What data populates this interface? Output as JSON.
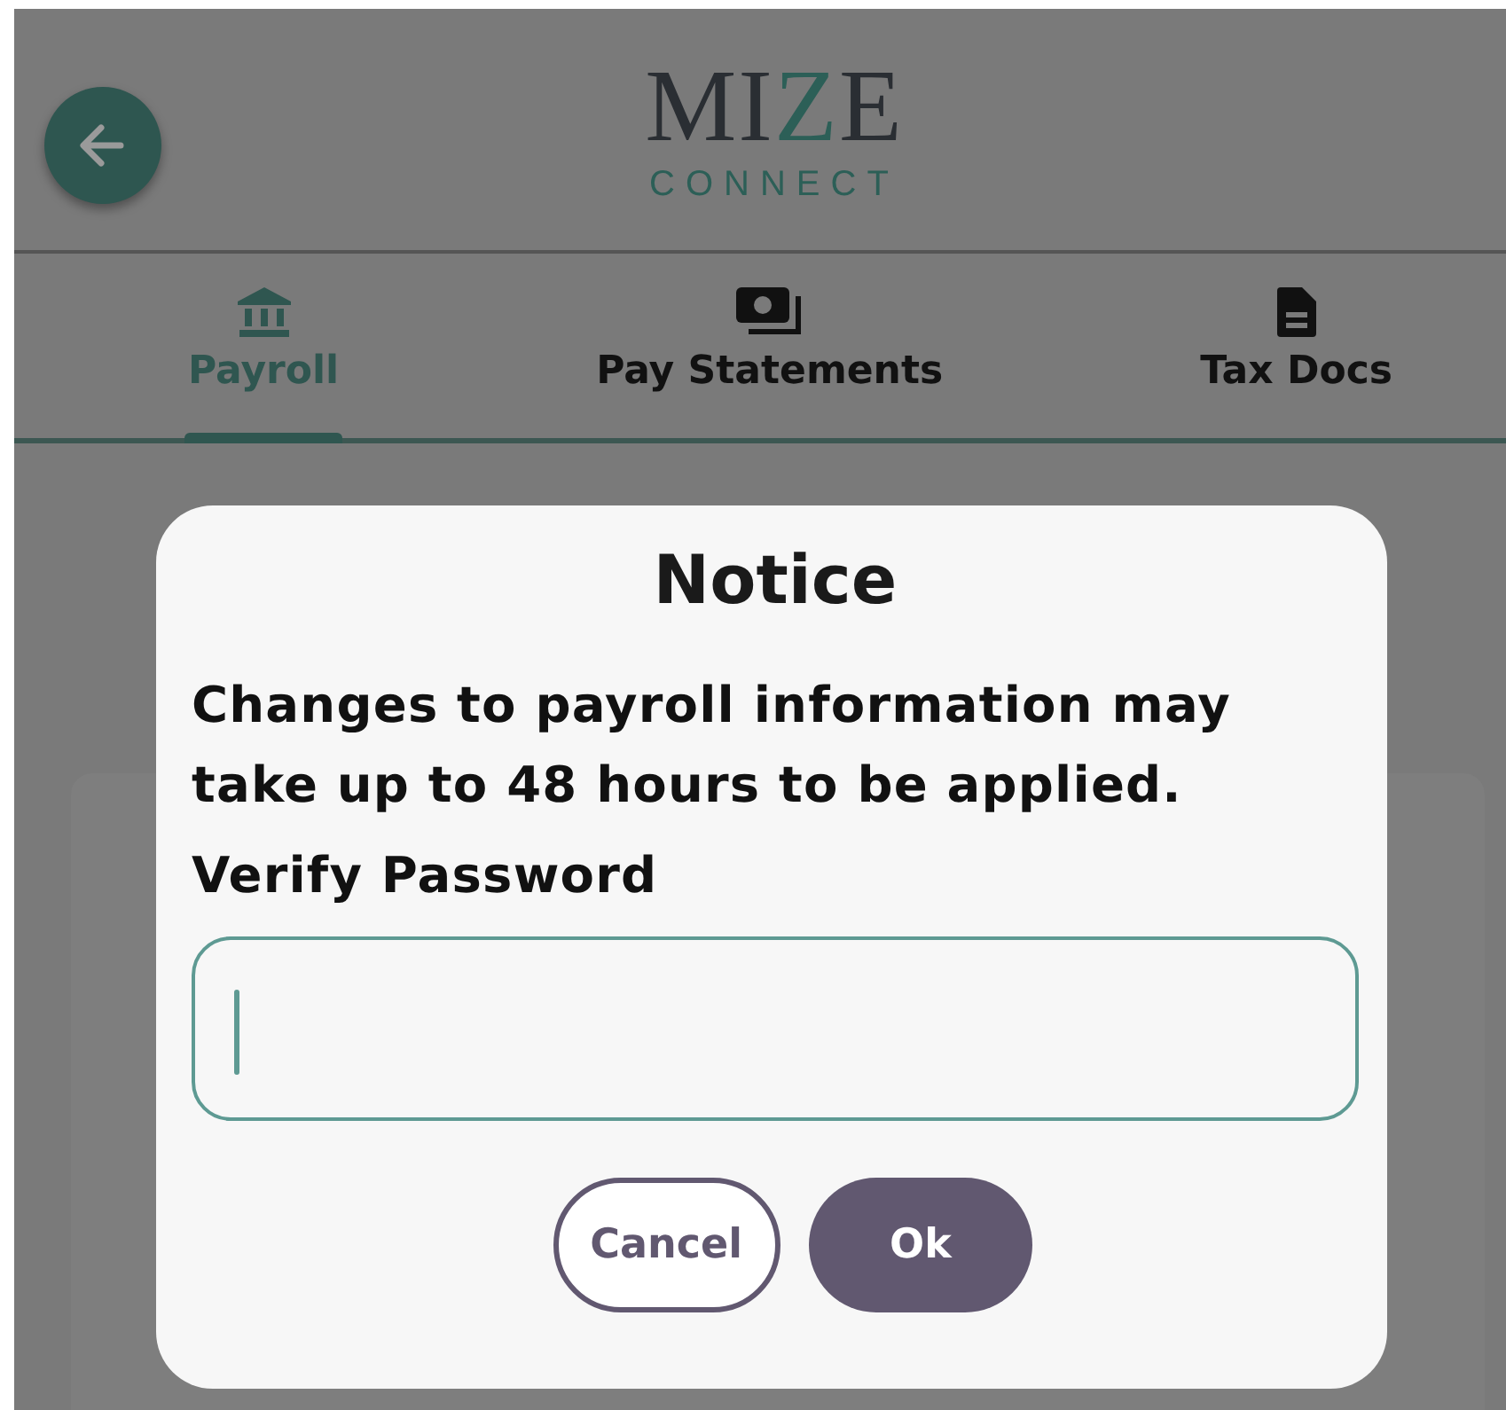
{
  "header": {
    "logo": {
      "parts": [
        {
          "text": "MI",
          "accent": false
        },
        {
          "text": "Z",
          "accent": true
        },
        {
          "text": "E",
          "accent": false
        }
      ],
      "tagline": "CONNECT"
    }
  },
  "tabs": [
    {
      "label": "Payroll",
      "kind": "bank",
      "selected": true
    },
    {
      "label": "Pay Statements",
      "kind": "money",
      "selected": false
    },
    {
      "label": "Tax Docs",
      "kind": "document",
      "selected": false
    }
  ],
  "dialog": {
    "title": "Notice",
    "message": "Changes to payroll information may take up to 48 hours to be applied.",
    "field_label": "Verify Password",
    "buttons": [
      {
        "label": "Cancel",
        "kind": "secondary"
      },
      {
        "label": "Ok",
        "kind": "primary"
      }
    ]
  }
}
